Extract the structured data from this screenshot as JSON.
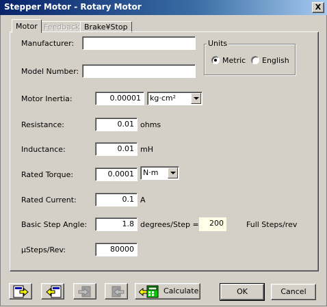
{
  "window": {
    "title": "Stepper Motor - Rotary Motor",
    "close_label": "X"
  },
  "tabs": [
    {
      "label": "Motor",
      "state": "active"
    },
    {
      "label": "Feedback",
      "state": "disabled"
    },
    {
      "label": "Brake¥Stop",
      "state": "normal"
    }
  ],
  "fields": {
    "manufacturer": {
      "label": "Manufacturer:",
      "value": ""
    },
    "model_number": {
      "label": "Model Number:",
      "value": ""
    },
    "motor_inertia": {
      "label": "Motor Inertia:",
      "value": "0.00001",
      "unit_selected": "kg·cm²"
    },
    "resistance": {
      "label": "Resistance:",
      "value": "0.01",
      "unit": "ohms"
    },
    "inductance": {
      "label": "Inductance:",
      "value": "0.01",
      "unit": "mH"
    },
    "rated_torque": {
      "label": "Rated Torque:",
      "value": "0.0001",
      "unit_selected": "N·m"
    },
    "rated_current": {
      "label": "Rated Current:",
      "value": "0.1",
      "unit": "A"
    },
    "basic_step_angle": {
      "label": "Basic Step Angle:",
      "value": "1.8",
      "unit": "degrees/Step =",
      "full_steps": "200",
      "full_steps_unit": "Full Steps/rev"
    },
    "microsteps": {
      "label": "µSteps/Rev:",
      "value": "80000"
    }
  },
  "units": {
    "title": "Units",
    "options": [
      {
        "label": "Metric",
        "checked": true
      },
      {
        "label": "English",
        "checked": false
      }
    ]
  },
  "buttons": {
    "calculate": "Calculate",
    "ok": "OK",
    "cancel": "Cancel"
  },
  "colors": {
    "titlebar_start": "#0a246a",
    "dialog_bg": "#d4d0c8",
    "readonly_bg": "#ffffe8"
  }
}
